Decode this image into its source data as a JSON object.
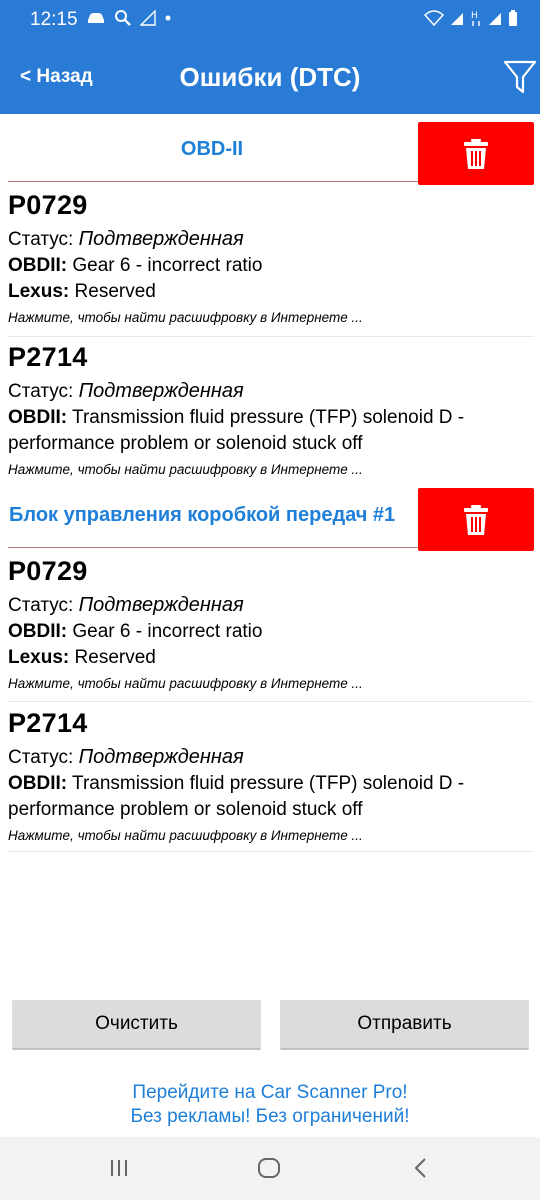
{
  "status_bar": {
    "time": "12:15",
    "icons_left": [
      "car-icon",
      "search-icon",
      "signal-icon",
      "dot-icon"
    ],
    "icons_right": [
      "wifi-icon",
      "signal-icon",
      "data-icon",
      "signal-icon",
      "battery-icon"
    ]
  },
  "app_bar": {
    "back_label": "< Назад",
    "title": "Ошибки (DTC)",
    "filter_icon": "filter-icon"
  },
  "colors": {
    "primary": "#2a7bd6",
    "link": "#1e7fd8",
    "delete": "#ff0000"
  },
  "sections": [
    {
      "title": "OBD-II",
      "delete_icon": "trash-icon",
      "dtcs": [
        {
          "code": "P0729",
          "status_label": "Статус:",
          "status_value": "Подтвержденная",
          "details": [
            {
              "key": "OBDII:",
              "value": "Gear 6 - incorrect ratio"
            },
            {
              "key": "Lexus:",
              "value": "Reserved"
            }
          ],
          "hint": "Нажмите, чтобы найти расшифровку в Интернете ..."
        },
        {
          "code": "P2714",
          "status_label": "Статус:",
          "status_value": "Подтвержденная",
          "details": [
            {
              "key": "OBDII:",
              "value": "Transmission fluid pressure (TFP) solenoid D - performance problem or solenoid stuck off"
            }
          ],
          "hint": "Нажмите, чтобы найти расшифровку в Интернете ..."
        }
      ]
    },
    {
      "title": "Блок управления коробкой передач #1",
      "delete_icon": "trash-icon",
      "dtcs": [
        {
          "code": "P0729",
          "status_label": "Статус:",
          "status_value": "Подтвержденная",
          "details": [
            {
              "key": "OBDII:",
              "value": "Gear 6 - incorrect ratio"
            },
            {
              "key": "Lexus:",
              "value": "Reserved"
            }
          ],
          "hint": "Нажмите, чтобы найти расшифровку в Интернете ..."
        },
        {
          "code": "P2714",
          "status_label": "Статус:",
          "status_value": "Подтвержденная",
          "details": [
            {
              "key": "OBDII:",
              "value": "Transmission fluid pressure (TFP) solenoid D - performance problem or solenoid stuck off"
            }
          ],
          "hint": "Нажмите, чтобы найти расшифровку в Интернете ..."
        }
      ]
    }
  ],
  "footer": {
    "clear_label": "Очистить",
    "send_label": "Отправить",
    "promo_line1": "Перейдите на Car Scanner Pro!",
    "promo_line2": "Без рекламы! Без ограничений!"
  },
  "nav_bar": {
    "icons": [
      "recent-apps-icon",
      "home-icon",
      "back-icon"
    ]
  }
}
